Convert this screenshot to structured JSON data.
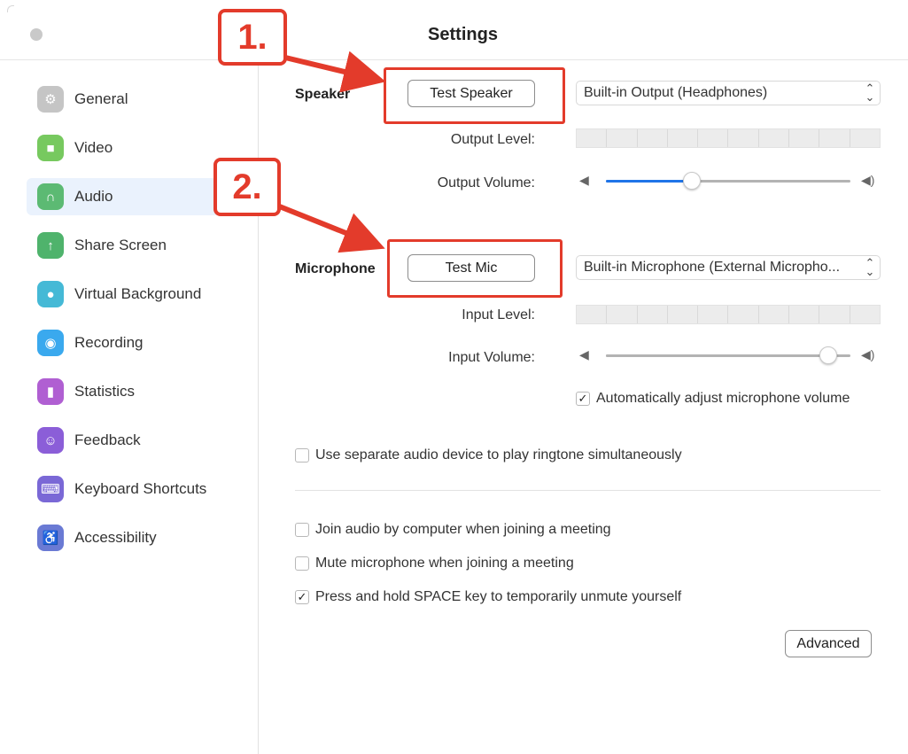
{
  "window": {
    "title": "Settings"
  },
  "sidebar": {
    "items": [
      {
        "label": "General",
        "icon": "gear-icon",
        "color": "#c5c5c5",
        "glyph": "⚙"
      },
      {
        "label": "Video",
        "icon": "video-camera-icon",
        "color": "#77c95f",
        "glyph": "■"
      },
      {
        "label": "Audio",
        "icon": "headphones-icon",
        "color": "#5cba73",
        "glyph": "∩"
      },
      {
        "label": "Share Screen",
        "icon": "share-screen-icon",
        "color": "#4fb36c",
        "glyph": "↑"
      },
      {
        "label": "Virtual Background",
        "icon": "person-icon",
        "color": "#45b9d6",
        "glyph": "●"
      },
      {
        "label": "Recording",
        "icon": "record-icon",
        "color": "#3aa9ee",
        "glyph": "◉"
      },
      {
        "label": "Statistics",
        "icon": "bar-chart-icon",
        "color": "#b05fd2",
        "glyph": "▮"
      },
      {
        "label": "Feedback",
        "icon": "smiley-icon",
        "color": "#8b5ed8",
        "glyph": "☺"
      },
      {
        "label": "Keyboard Shortcuts",
        "icon": "keyboard-icon",
        "color": "#7a68d6",
        "glyph": "⌨"
      },
      {
        "label": "Accessibility",
        "icon": "accessibility-icon",
        "color": "#6a7ad4",
        "glyph": "♿"
      }
    ],
    "active_index": 2
  },
  "speaker": {
    "label": "Speaker",
    "test_button": "Test Speaker",
    "device": "Built-in Output (Headphones)",
    "output_level_label": "Output Level:",
    "output_volume_label": "Output Volume:",
    "output_volume_level": 0.35
  },
  "microphone": {
    "label": "Microphone",
    "test_button": "Test Mic",
    "device": "Built-in Microphone (External Micropho...",
    "input_level_label": "Input Level:",
    "input_volume_label": "Input Volume:",
    "input_volume_level": 0.91,
    "auto_adjust": {
      "label": "Automatically adjust microphone volume",
      "checked": true
    }
  },
  "options": {
    "separate_ringtone": {
      "label": "Use separate audio device to play ringtone simultaneously",
      "checked": false
    },
    "join_audio": {
      "label": "Join audio by computer when joining a meeting",
      "checked": false
    },
    "mute_on_join": {
      "label": "Mute microphone when joining a meeting",
      "checked": false
    },
    "space_unmute": {
      "label": "Press and hold SPACE key to temporarily unmute yourself",
      "checked": true
    }
  },
  "advanced_button": "Advanced",
  "annotations": {
    "step1": "1.",
    "step2": "2.",
    "color": "#e33b2b"
  },
  "colors": {
    "accent": "#1f74e8",
    "active_bg": "#eaf2fd"
  }
}
